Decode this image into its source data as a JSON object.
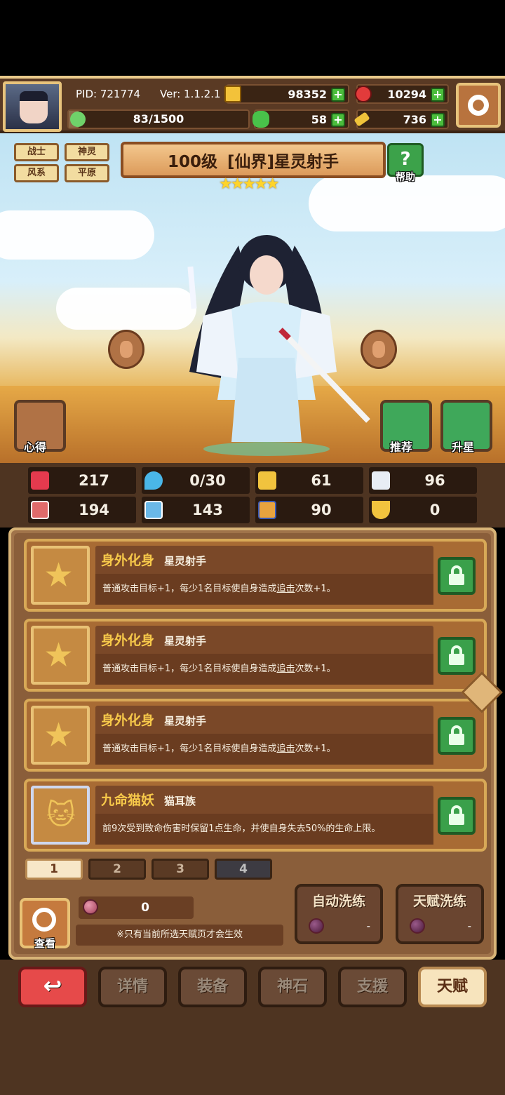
{
  "header": {
    "pid": "PID: 721774",
    "version": "Ver: 1.1.2.1",
    "gold": "98352",
    "gems": "10294",
    "energy": "83/1500",
    "energy_fraction": 0.055,
    "clover": "58",
    "keys": "736"
  },
  "hero": {
    "tags": [
      "战士",
      "神灵",
      "风系",
      "平原"
    ],
    "level_title": "100级",
    "name": "[仙界]星灵射手",
    "stars": "★★★★★",
    "help_label": "帮助",
    "left_side_label": "心得",
    "recommend_label": "推荐",
    "upstar_label": "升星"
  },
  "stats": {
    "hp": "217",
    "mana": "0/30",
    "defense": "61",
    "speed": "96",
    "attack": "194",
    "magic": "143",
    "block": "90",
    "luck": "0"
  },
  "talents": [
    {
      "title": "身外化身",
      "sub": "星灵射手",
      "desc_a": "普通攻击目标+1，每少1名目标使自身造成",
      "desc_u": "追击",
      "desc_b": "次数+1。"
    },
    {
      "title": "身外化身",
      "sub": "星灵射手",
      "desc_a": "普通攻击目标+1，每少1名目标使自身造成",
      "desc_u": "追击",
      "desc_b": "次数+1。"
    },
    {
      "title": "身外化身",
      "sub": "星灵射手",
      "desc_a": "普通攻击目标+1，每少1名目标使自身造成",
      "desc_u": "追击",
      "desc_b": "次数+1。"
    },
    {
      "title": "九命猫妖",
      "sub": "猫耳族",
      "desc_a": "前9次受到致命伤害时保留1点生命，并使自身失去50%的生命上限。",
      "desc_u": "",
      "desc_b": ""
    }
  ],
  "pages": [
    "1",
    "2",
    "3",
    "4"
  ],
  "bottom": {
    "fruit_count": "0",
    "note": "※只有当前所选天赋页才会生效",
    "view_label": "查看",
    "auto_wash": "自动洗练",
    "auto_wash_cost": "-",
    "talent_wash": "天赋洗练",
    "talent_wash_cost": "-"
  },
  "nav": {
    "back_icon": "return-arrow-icon",
    "details": "详情",
    "equipment": "装备",
    "godstone": "神石",
    "support": "支援",
    "talent": "天赋"
  }
}
